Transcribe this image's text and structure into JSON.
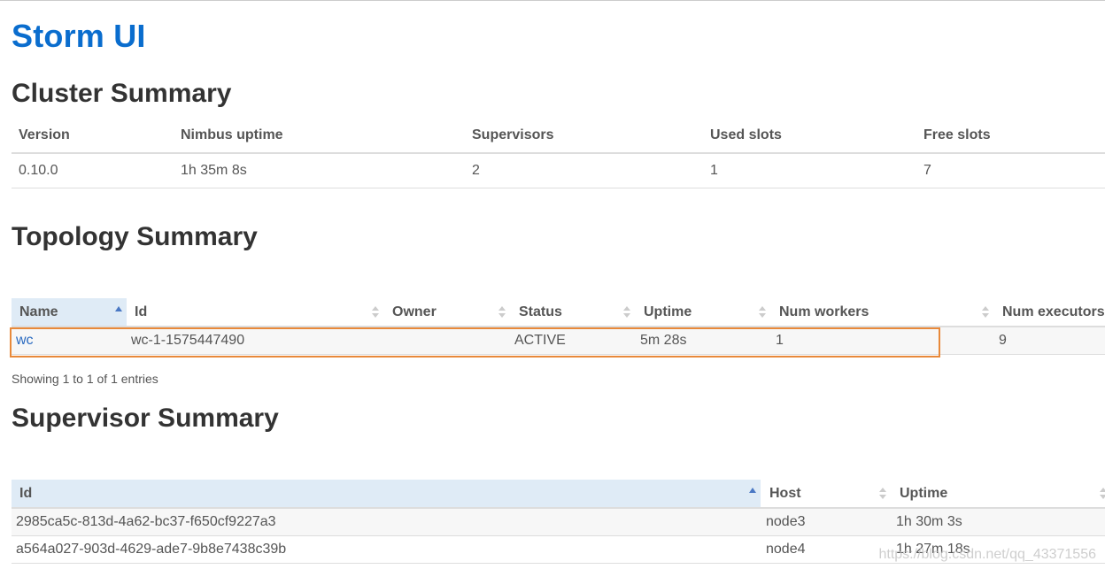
{
  "app_title": "Storm UI",
  "cluster_summary": {
    "heading": "Cluster Summary",
    "columns": [
      "Version",
      "Nimbus uptime",
      "Supervisors",
      "Used slots",
      "Free slots"
    ],
    "row": [
      "0.10.0",
      "1h 35m 8s",
      "2",
      "1",
      "7"
    ]
  },
  "topology_summary": {
    "heading": "Topology Summary",
    "columns": [
      "Name",
      "Id",
      "Owner",
      "Status",
      "Uptime",
      "Num workers",
      "Num executors"
    ],
    "row": {
      "name": "wc",
      "id": "wc-1-1575447490",
      "owner": "",
      "status": "ACTIVE",
      "uptime": "5m 28s",
      "num_workers": "1",
      "num_executors": "9"
    },
    "info": "Showing 1 to 1 of 1 entries"
  },
  "supervisor_summary": {
    "heading": "Supervisor Summary",
    "columns": [
      "Id",
      "Host",
      "Uptime"
    ],
    "rows": [
      {
        "id": "2985ca5c-813d-4a62-bc37-f650cf9227a3",
        "host": "node3",
        "uptime": "1h 30m 3s"
      },
      {
        "id": "a564a027-903d-4629-ade7-9b8e7438c39b",
        "host": "node4",
        "uptime": "1h 27m 18s"
      }
    ]
  },
  "watermark": "https://blog.csdn.net/qq_43371556",
  "colors": {
    "title": "#0a6dce",
    "sorted_header_bg": "#dfebf6",
    "highlight_border": "#e8893a",
    "link": "#2a6ac0"
  }
}
